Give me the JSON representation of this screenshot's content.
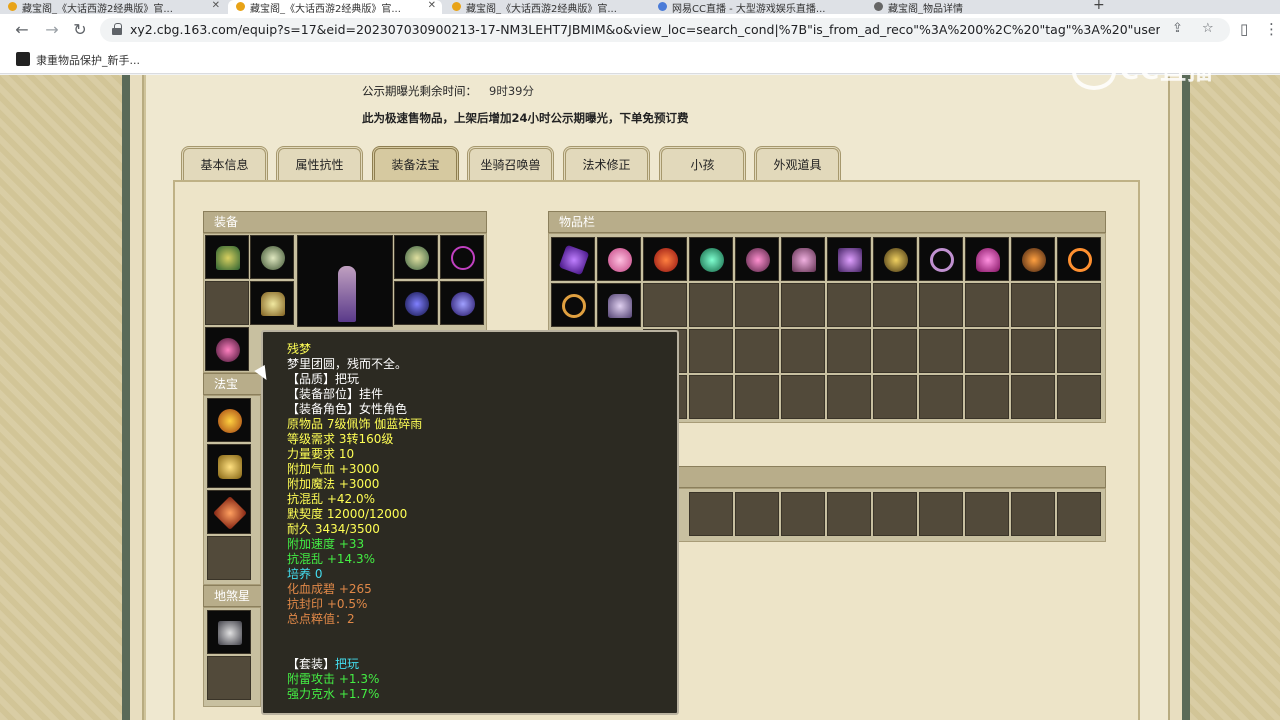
{
  "browser": {
    "tabs": [
      {
        "label": "藏宝阁_《大话西游2经典版》官..."
      },
      {
        "label": "藏宝阁_《大话西游2经典版》官..."
      },
      {
        "label": "藏宝阁_《大话西游2经典版》官..."
      },
      {
        "label": "网易CC直播 - 大型游戏娱乐直播..."
      },
      {
        "label": "藏宝阁_《大话西游2经典版》官..."
      },
      {
        "label": "藏宝阁_物品详情"
      }
    ],
    "url": "xy2.cbg.163.com/equip?s=17&eid=202307030900213-17-NM3LEHT7JBMIM&o&view_loc=search_cond|%7B\"is_from_ad_reco\"%3A%200%2C%20\"tag\"%3A%20\"user\"%7...",
    "bookmark": "隶重物品保护_新手...",
    "watermark": "CC直播"
  },
  "notice": {
    "timer_label": "公示期曝光剩余时间：",
    "timer_value": "9时39分",
    "fast_sell": "此为极速售物品，上架后增加24小时公示期曝光，下单免预订费"
  },
  "tabs": [
    "基本信息",
    "属性抗性",
    "装备法宝",
    "坐骑召唤兽",
    "法术修正",
    "小孩",
    "外观道具"
  ],
  "active_tab": "装备法宝",
  "sections": {
    "equip": "装备",
    "treasure": "法宝",
    "star": "地煞星",
    "inventory": "物品栏"
  },
  "tooltip": {
    "name": "残梦",
    "desc": "梦里团圆，残而不全。",
    "quality": "【品质】把玩",
    "part": "【装备部位】挂件",
    "role": "【装备角色】女性角色",
    "origin": "原物品 7级佩饰 伽蓝碎雨",
    "level": "等级需求 3转160级",
    "strength": "力量要求 10",
    "hp": "附加气血 +3000",
    "mp": "附加魔法 +3000",
    "anti_chaos": "抗混乱 +42.0%",
    "bond": "默契度 12000/12000",
    "durability": "耐久 3434/3500",
    "speed": "附加速度 +33",
    "anti_chaos2": "抗混乱 +14.3%",
    "cultivate": "培养 0",
    "blood": "化血成碧 +265",
    "anti_seal": "抗封印 +0.5%",
    "total": "总点粹值：2",
    "set_label": "【套装】",
    "set_name": "把玩",
    "thunder": "附雷攻击 +1.3%",
    "water": "强力克水 +1.7%"
  },
  "colors": {
    "tooltip_bg": "#2c2a22",
    "yellow": "#ffff55",
    "green": "#44ee44",
    "cyan": "#44ddee",
    "orange": "#e08848"
  }
}
